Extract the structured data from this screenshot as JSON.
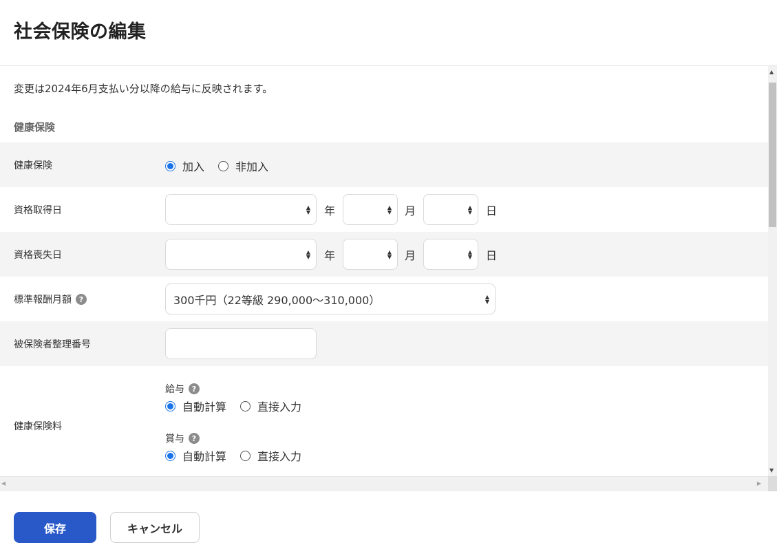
{
  "page": {
    "title": "社会保険の編集"
  },
  "notice": "変更は2024年6月支払い分以降の給与に反映されます。",
  "section": {
    "heading": "健康保険"
  },
  "health_insurance": {
    "label": "健康保険",
    "options": [
      "加入",
      "非加入"
    ],
    "selected": "加入"
  },
  "acquisition_date": {
    "label": "資格取得日",
    "year_value": "",
    "month_value": "",
    "day_value": "",
    "year_unit": "年",
    "month_unit": "月",
    "day_unit": "日"
  },
  "loss_date": {
    "label": "資格喪失日",
    "year_value": "",
    "month_value": "",
    "day_value": "",
    "year_unit": "年",
    "month_unit": "月",
    "day_unit": "日"
  },
  "standard_monthly": {
    "label": "標準報酬月額",
    "selected_value": "300千円（22等級 290,000～310,000）"
  },
  "insured_number": {
    "label": "被保険者整理番号",
    "value": ""
  },
  "premium": {
    "label": "健康保険料",
    "salary": {
      "label": "給与",
      "options": [
        "自動計算",
        "直接入力"
      ],
      "selected": "自動計算"
    },
    "bonus": {
      "label": "賞与",
      "options": [
        "自動計算",
        "直接入力"
      ],
      "selected": "自動計算"
    }
  },
  "help_icon_glyph": "?",
  "footer": {
    "save_label": "保存",
    "cancel_label": "キャンセル"
  },
  "colors": {
    "primary": "#2958c9",
    "radio_checked": "#1a73e8",
    "row_shade": "#f5f4f4"
  }
}
